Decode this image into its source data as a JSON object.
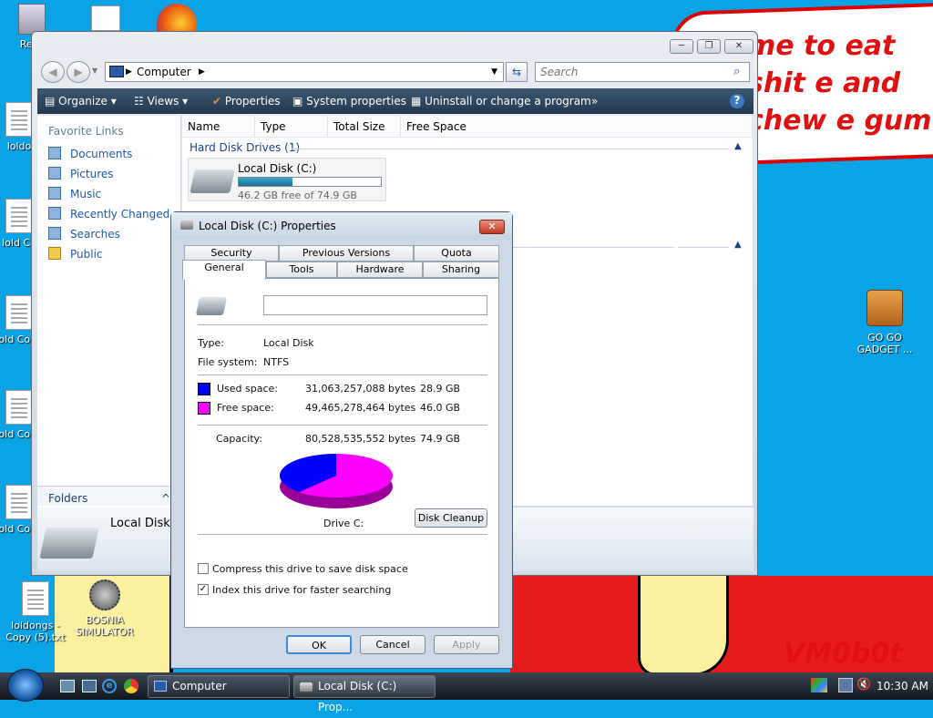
{
  "desktop": {
    "bubble_text": "me to eat shit e and chew e gum",
    "signature": "VM0b0t",
    "icons": [
      {
        "label": "Recy"
      },
      {
        "label": "loldo"
      },
      {
        "label": "lold Co"
      },
      {
        "label": "lold Copy"
      },
      {
        "label": "lold Copy"
      },
      {
        "label": "lold Copy"
      },
      {
        "label": "loldongs - Copy (5).txt"
      },
      {
        "label": "BOSNIA SIMULATOR"
      },
      {
        "label": "GO GO GADGET ..."
      }
    ]
  },
  "explorer": {
    "address": "Computer",
    "search_placeholder": "Search",
    "toolbar": {
      "organize": "Organize",
      "views": "Views",
      "properties": "Properties",
      "system_properties": "System properties",
      "uninstall": "Uninstall or change a program",
      "more": "»",
      "help": "?"
    },
    "favorite_links_title": "Favorite Links",
    "favorites": [
      "Documents",
      "Pictures",
      "Music",
      "Recently Changed",
      "Searches",
      "Public"
    ],
    "folders_label": "Folders",
    "columns": [
      "Name",
      "Type",
      "Total Size",
      "Free Space"
    ],
    "group_hdd": "Hard Disk Drives (1)",
    "drive": {
      "name": "Local Disk (C:)",
      "free_text": "46.2 GB free of 74.9 GB",
      "used_fraction": 0.38
    },
    "details_label": "Local Disk ("
  },
  "dialog": {
    "title": "Local Disk (C:) Properties",
    "tabs_row1": [
      "Security",
      "Previous Versions",
      "Quota"
    ],
    "tabs_row2": [
      "General",
      "Tools",
      "Hardware",
      "Sharing"
    ],
    "name_value": "",
    "type_label": "Type:",
    "type_value": "Local Disk",
    "fs_label": "File system:",
    "fs_value": "NTFS",
    "used_label": "Used space:",
    "used_bytes": "31,063,257,088 bytes",
    "used_gb": "28.9 GB",
    "free_label": "Free space:",
    "free_bytes": "49,465,278,464 bytes",
    "free_gb": "46.0 GB",
    "capacity_label": "Capacity:",
    "capacity_bytes": "80,528,535,552 bytes",
    "capacity_gb": "74.9 GB",
    "drive_label": "Drive C:",
    "disk_cleanup": "Disk Cleanup",
    "compress_label": "Compress this drive to save disk space",
    "index_label": "Index this drive for faster searching",
    "ok": "OK",
    "cancel": "Cancel",
    "apply": "Apply",
    "colors": {
      "used": "#0000ff",
      "free": "#ff00ff"
    }
  },
  "taskbar": {
    "items": [
      "Computer",
      "Local Disk (C:) Prop..."
    ],
    "clock": "10:30 AM"
  }
}
